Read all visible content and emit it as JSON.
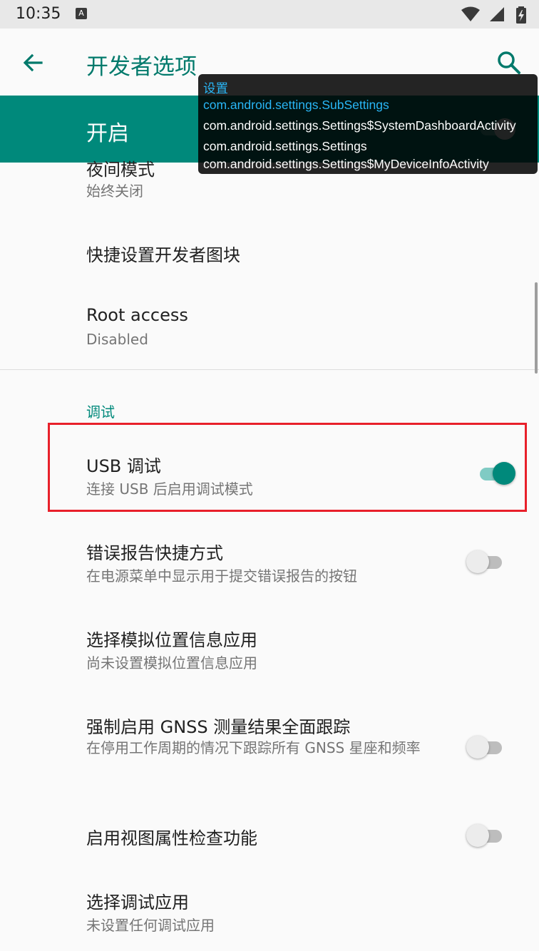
{
  "status_bar": {
    "time": "10:35",
    "notif_letter": "A"
  },
  "app_bar": {
    "title": "开发者选项"
  },
  "master_switch": {
    "label": "开启"
  },
  "overlay": {
    "lines": [
      "设置",
      "com.android.settings.SubSettings",
      "com.android.settings.Settings$SystemDashboardActivity",
      "com.android.settings.Settings",
      "com.android.settings.Settings$MyDeviceInfoActivity"
    ]
  },
  "list": {
    "night_mode": {
      "title": "夜间模式",
      "subtitle": "始终关闭"
    },
    "quick_tiles": {
      "title": "快捷设置开发者图块"
    },
    "root_access": {
      "title": "Root access",
      "subtitle": "Disabled"
    },
    "section_debug": "调试",
    "usb_debug": {
      "title": "USB 调试",
      "subtitle": "连接 USB 后启用调试模式",
      "enabled": true
    },
    "bug_report": {
      "title": "错误报告快捷方式",
      "subtitle": "在电源菜单中显示用于提交错误报告的按钮",
      "enabled": false
    },
    "mock_location": {
      "title": "选择模拟位置信息应用",
      "subtitle": "尚未设置模拟位置信息应用"
    },
    "gnss": {
      "title": "强制启用 GNSS 测量结果全面跟踪",
      "subtitle": "在停用工作周期的情况下跟踪所有 GNSS 星座和频率",
      "enabled": false
    },
    "view_attr": {
      "title": "启用视图属性检查功能",
      "enabled": false
    },
    "debug_app": {
      "title": "选择调试应用",
      "subtitle": "未设置任何调试应用"
    }
  },
  "colors": {
    "accent": "#00897b",
    "title_teal": "#00796b",
    "highlight_red": "#e8202a"
  }
}
